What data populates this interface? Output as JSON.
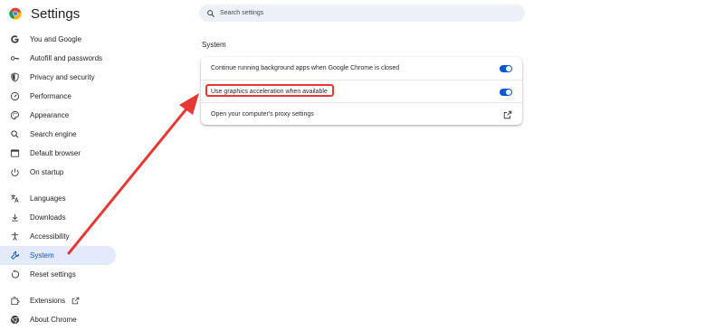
{
  "header": {
    "title": "Settings",
    "search_placeholder": "Search settings",
    "logo": "chrome-logo"
  },
  "sidebar": {
    "items": [
      {
        "label": "You and Google",
        "icon": "google-g-icon",
        "active": false
      },
      {
        "label": "Autofill and passwords",
        "icon": "key-icon",
        "active": false
      },
      {
        "label": "Privacy and security",
        "icon": "shield-icon",
        "active": false
      },
      {
        "label": "Performance",
        "icon": "speedometer-icon",
        "active": false
      },
      {
        "label": "Appearance",
        "icon": "palette-icon",
        "active": false
      },
      {
        "label": "Search engine",
        "icon": "search-icon",
        "active": false
      },
      {
        "label": "Default browser",
        "icon": "browser-window-icon",
        "active": false
      },
      {
        "label": "On startup",
        "icon": "power-icon",
        "active": false
      },
      {
        "label": "Languages",
        "icon": "translate-icon",
        "active": false
      },
      {
        "label": "Downloads",
        "icon": "download-icon",
        "active": false
      },
      {
        "label": "Accessibility",
        "icon": "accessibility-icon",
        "active": false
      },
      {
        "label": "System",
        "icon": "wrench-icon",
        "active": true
      },
      {
        "label": "Reset settings",
        "icon": "reset-icon",
        "active": false
      },
      {
        "label": "Extensions",
        "icon": "puzzle-icon",
        "active": false
      },
      {
        "label": "About Chrome",
        "icon": "chrome-icon",
        "active": false
      }
    ]
  },
  "main": {
    "section_title": "System",
    "rows": [
      {
        "label": "Continue running background apps when Google Chrome is closed",
        "control": "toggle",
        "checked": true
      },
      {
        "label": "Use graphics acceleration when available",
        "control": "toggle",
        "checked": true
      },
      {
        "label": "Open your computer's proxy settings",
        "control": "external-link"
      }
    ]
  },
  "colors": {
    "accent": "#0b57d0",
    "active_nav_bg": "#e3eafb",
    "annotation": "#e53935"
  }
}
